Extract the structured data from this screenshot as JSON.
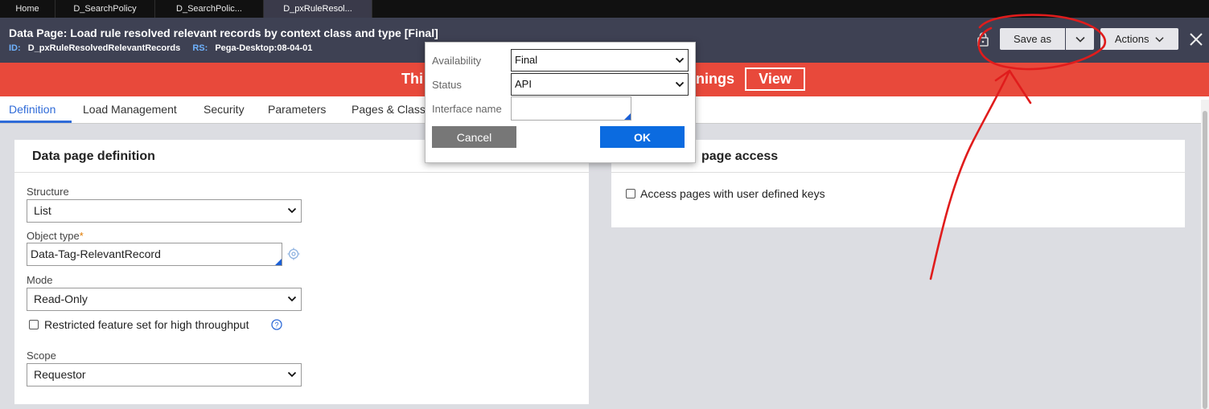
{
  "tabs": [
    {
      "label": "Home"
    },
    {
      "label": "D_SearchPolicy"
    },
    {
      "label": "D_SearchPolic..."
    },
    {
      "label": "D_pxRuleResol..."
    }
  ],
  "header": {
    "title": "Data Page: Load rule resolved relevant records by context class and type",
    "status_badge": "[Final]",
    "id_key": "ID:",
    "id_value": "D_pxRuleResolvedRelevantRecords",
    "rs_key": "RS:",
    "rs_value": "Pega-Desktop:08-04-01",
    "save_as_label": "Save as",
    "actions_label": "Actions"
  },
  "banner": {
    "text_left": "Thi",
    "text_right": "rnings",
    "view_label": "View"
  },
  "rule_tabs": [
    {
      "label": "Definition"
    },
    {
      "label": "Load Management"
    },
    {
      "label": "Security"
    },
    {
      "label": "Parameters"
    },
    {
      "label": "Pages & Class"
    }
  ],
  "definition": {
    "title": "Data page definition",
    "structure_label": "Structure",
    "structure_value": "List",
    "object_type_label": "Object type",
    "object_type_required": "*",
    "object_type_value": "Data-Tag-RelevantRecord",
    "mode_label": "Mode",
    "mode_value": "Read-Only",
    "restricted_label": "Restricted feature set for high throughput",
    "scope_label": "Scope",
    "scope_value": "Requestor"
  },
  "keyed_access": {
    "title": "page access",
    "checkbox_label": "Access pages with user defined keys"
  },
  "popup": {
    "availability_label": "Availability",
    "availability_value": "Final",
    "status_label": "Status",
    "status_value": "API",
    "interface_label": "Interface name",
    "interface_value": "",
    "cancel_label": "Cancel",
    "ok_label": "OK"
  },
  "colors": {
    "banner": "#e8493b",
    "header": "#3e4153",
    "accent": "#2f6bd8",
    "ok_button": "#0b6be0",
    "annotation": "#e01c1c"
  }
}
